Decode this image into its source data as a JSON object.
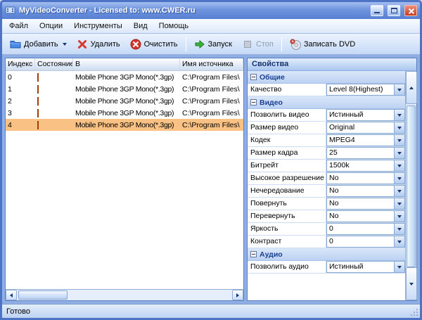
{
  "window": {
    "title": "MyVideoConverter - Licensed to: www.CWER.ru"
  },
  "menu": {
    "items": [
      {
        "label": "Файл"
      },
      {
        "label": "Опции"
      },
      {
        "label": "Инструменты"
      },
      {
        "label": "Вид"
      },
      {
        "label": "Помощь"
      }
    ]
  },
  "toolbar": {
    "add": "Добавить",
    "delete": "Удалить",
    "clear": "Очистить",
    "start": "Запуск",
    "stop": "Стоп",
    "record": "Записать DVD"
  },
  "filelist": {
    "columns": [
      "Индекс",
      "Состояние",
      "В",
      "Имя источника"
    ],
    "rows": [
      {
        "index": "0",
        "format": "Mobile Phone 3GP Mono(*.3gp)",
        "source": "C:\\Program Files\\"
      },
      {
        "index": "1",
        "format": "Mobile Phone 3GP Mono(*.3gp)",
        "source": "C:\\Program Files\\"
      },
      {
        "index": "2",
        "format": "Mobile Phone 3GP Mono(*.3gp)",
        "source": "C:\\Program Files\\"
      },
      {
        "index": "3",
        "format": "Mobile Phone 3GP Mono(*.3gp)",
        "source": "C:\\Program Files\\"
      },
      {
        "index": "4",
        "format": "Mobile Phone 3GP Mono(*.3gp)",
        "source": "C:\\Program Files\\"
      }
    ]
  },
  "properties": {
    "title": "Свойства",
    "groups": [
      {
        "label": "Общие",
        "rows": [
          {
            "label": "Качество",
            "value": "Level 8(Highest)"
          }
        ]
      },
      {
        "label": "Видео",
        "rows": [
          {
            "label": "Позволить видео",
            "value": "Истинный"
          },
          {
            "label": "Размер видео",
            "value": "Original"
          },
          {
            "label": "Кодек",
            "value": "MPEG4"
          },
          {
            "label": "Размер кадра",
            "value": "25"
          },
          {
            "label": "Битрейт",
            "value": "1500k"
          },
          {
            "label": "Высокое разрешение",
            "value": "No"
          },
          {
            "label": "Нечередование",
            "value": "No"
          },
          {
            "label": "Повернуть",
            "value": "No"
          },
          {
            "label": "Перевернуть",
            "value": "No"
          },
          {
            "label": "Яркость",
            "value": "0"
          },
          {
            "label": "Контраст",
            "value": "0"
          }
        ]
      },
      {
        "label": "Аудио",
        "rows": [
          {
            "label": "Позволить аудио",
            "value": "Истинный"
          }
        ]
      }
    ]
  },
  "statusbar": {
    "text": "Готово"
  },
  "colors": {
    "selected_row": "#f9c184",
    "status_square": "#ff7631",
    "status_square_border": "#a83c00",
    "group_header_text": "#1b3f8f"
  }
}
